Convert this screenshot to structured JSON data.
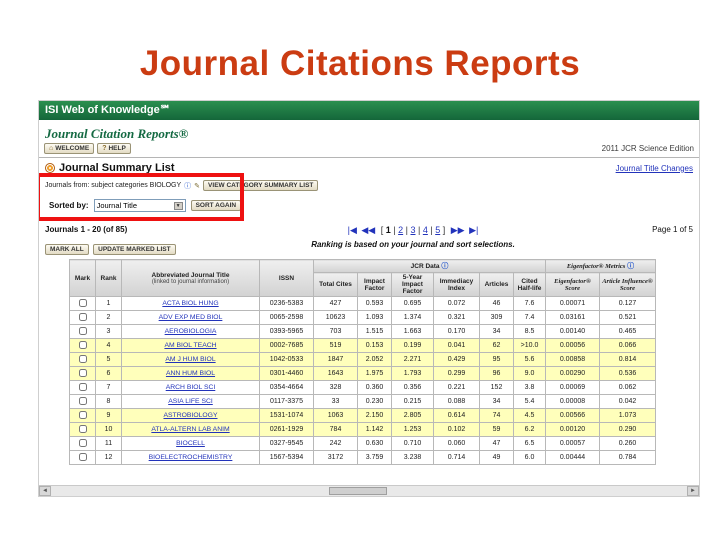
{
  "slide": {
    "title": "Journal Citations Reports"
  },
  "colors": {
    "title": "#cb3c12",
    "banner_green": "#1a7d41",
    "annotation_red": "#ee1111",
    "link_blue": "#2233bb",
    "row_highlight": "#ffffbb"
  },
  "icons": {
    "home": "⌂",
    "question": "?",
    "info": "ⓘ",
    "edit": "✎",
    "dropdown": "▼",
    "scroll_left": "◄",
    "scroll_right": "►"
  },
  "app": {
    "banner": "ISI Web of Knowledge℠",
    "product": "Journal Citation Reports®",
    "edition": "2011 JCR Science Edition",
    "toolbar": {
      "welcome": "WELCOME",
      "help": "HELP"
    },
    "section": {
      "heading": "Journal Summary List",
      "title_changes_link": "Journal Title Changes"
    },
    "filters": {
      "journals_from": "Journals from: subject categories BIOLOGY",
      "view_category_button": "VIEW CATEGORY SUMMARY LIST",
      "sorted_by_label": "Sorted by:",
      "sort_value": "Journal Title",
      "sort_again_button": "SORT AGAIN"
    },
    "results": {
      "range": "Journals 1 - 20 (of 85)",
      "mark_all_button": "MARK ALL",
      "update_marked_button": "UPDATE MARKED LIST",
      "page_indicator": "Page 1 of 5",
      "ranking_note": "Ranking is based on your journal and sort selections.",
      "pagination": {
        "first": "|◀",
        "prev": "◀◀",
        "pages": [
          "1",
          "2",
          "3",
          "4",
          "5"
        ],
        "current": "1",
        "next": "▶▶",
        "last": "▶|"
      }
    },
    "table": {
      "group_headers": {
        "jcr_data": "JCR Data",
        "eigenfactor": "Eigenfactor® Metrics"
      },
      "title_note": "(linked to journal information)",
      "columns": [
        "Mark",
        "Rank",
        "Abbreviated Journal Title",
        "ISSN",
        "Total Cites",
        "Impact Factor",
        "5-Year Impact Factor",
        "Immediacy Index",
        "Articles",
        "Cited Half-life",
        "Eigenfactor® Score",
        "Article Influence® Score"
      ],
      "rows": [
        {
          "rank": 1,
          "title": "ACTA BIOL HUNG",
          "issn": "0236-5383",
          "values": [
            "427",
            "0.593",
            "0.695",
            "0.072",
            "46",
            "7.6",
            "0.00071",
            "0.127"
          ],
          "highlighted": false
        },
        {
          "rank": 2,
          "title": "ADV EXP MED BIOL",
          "issn": "0065-2598",
          "values": [
            "10623",
            "1.093",
            "1.374",
            "0.321",
            "309",
            "7.4",
            "0.03161",
            "0.521"
          ],
          "highlighted": false
        },
        {
          "rank": 3,
          "title": "AEROBIOLOGIA",
          "issn": "0393-5965",
          "values": [
            "703",
            "1.515",
            "1.663",
            "0.170",
            "34",
            "8.5",
            "0.00140",
            "0.465"
          ],
          "highlighted": false
        },
        {
          "rank": 4,
          "title": "AM BIOL TEACH",
          "issn": "0002-7685",
          "values": [
            "519",
            "0.153",
            "0.199",
            "0.041",
            "62",
            ">10.0",
            "0.00056",
            "0.066"
          ],
          "highlighted": true
        },
        {
          "rank": 5,
          "title": "AM J HUM BIOL",
          "issn": "1042-0533",
          "values": [
            "1847",
            "2.052",
            "2.271",
            "0.429",
            "95",
            "5.6",
            "0.00858",
            "0.814"
          ],
          "highlighted": true
        },
        {
          "rank": 6,
          "title": "ANN HUM BIOL",
          "issn": "0301-4460",
          "values": [
            "1643",
            "1.975",
            "1.793",
            "0.299",
            "96",
            "9.0",
            "0.00290",
            "0.536"
          ],
          "highlighted": true
        },
        {
          "rank": 7,
          "title": "ARCH BIOL SCI",
          "issn": "0354-4664",
          "values": [
            "328",
            "0.360",
            "0.356",
            "0.221",
            "152",
            "3.8",
            "0.00069",
            "0.062"
          ],
          "highlighted": false
        },
        {
          "rank": 8,
          "title": "ASIA LIFE SCI",
          "issn": "0117-3375",
          "values": [
            "33",
            "0.230",
            "0.215",
            "0.088",
            "34",
            "5.4",
            "0.00008",
            "0.042"
          ],
          "highlighted": false
        },
        {
          "rank": 9,
          "title": "ASTROBIOLOGY",
          "issn": "1531-1074",
          "values": [
            "1063",
            "2.150",
            "2.805",
            "0.614",
            "74",
            "4.5",
            "0.00566",
            "1.073"
          ],
          "highlighted": true
        },
        {
          "rank": 10,
          "title": "ATLA-ALTERN LAB ANIM",
          "issn": "0261-1929",
          "values": [
            "784",
            "1.142",
            "1.253",
            "0.102",
            "59",
            "6.2",
            "0.00120",
            "0.290"
          ],
          "highlighted": true
        },
        {
          "rank": 11,
          "title": "BIOCELL",
          "issn": "0327-9545",
          "values": [
            "242",
            "0.630",
            "0.710",
            "0.060",
            "47",
            "6.5",
            "0.00057",
            "0.260"
          ],
          "highlighted": false
        },
        {
          "rank": 12,
          "title": "BIOELECTROCHEMISTRY",
          "issn": "1567-5394",
          "values": [
            "3172",
            "3.759",
            "3.238",
            "0.714",
            "49",
            "6.0",
            "0.00444",
            "0.784"
          ],
          "highlighted": false
        }
      ]
    }
  }
}
